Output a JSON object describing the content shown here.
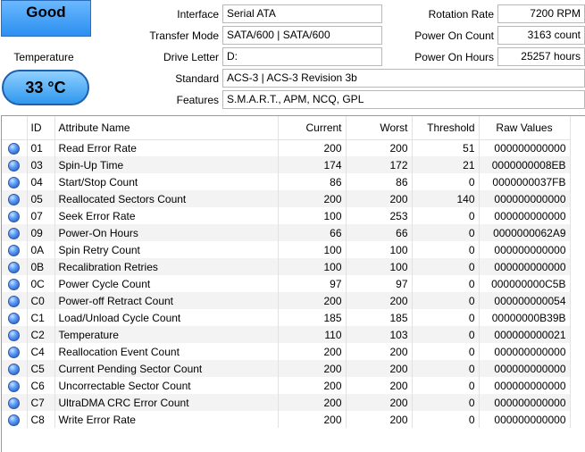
{
  "health": {
    "status": "Good"
  },
  "temperature": {
    "label": "Temperature",
    "value": "33 °C"
  },
  "info": {
    "interface": {
      "label": "Interface",
      "value": "Serial ATA"
    },
    "transfer_mode": {
      "label": "Transfer Mode",
      "value": "SATA/600 | SATA/600"
    },
    "drive_letter": {
      "label": "Drive Letter",
      "value": "D:"
    },
    "standard": {
      "label": "Standard",
      "value": "ACS-3 | ACS-3 Revision 3b"
    },
    "features": {
      "label": "Features",
      "value": "S.M.A.R.T., APM, NCQ, GPL"
    },
    "rotation_rate": {
      "label": "Rotation Rate",
      "value": "7200 RPM"
    },
    "power_on_count": {
      "label": "Power On Count",
      "value": "3163 count"
    },
    "power_on_hours": {
      "label": "Power On Hours",
      "value": "25257 hours"
    }
  },
  "colors": {
    "status_good": "#3a93ef",
    "status_dot": "#2f6fe0"
  },
  "table": {
    "headers": {
      "id": "ID",
      "name": "Attribute Name",
      "current": "Current",
      "worst": "Worst",
      "threshold": "Threshold",
      "raw": "Raw Values"
    },
    "status_icon": "status-dot-icon",
    "rows": [
      {
        "id": "01",
        "name": "Read Error Rate",
        "current": "200",
        "worst": "200",
        "threshold": "51",
        "raw": "000000000000"
      },
      {
        "id": "03",
        "name": "Spin-Up Time",
        "current": "174",
        "worst": "172",
        "threshold": "21",
        "raw": "0000000008EB"
      },
      {
        "id": "04",
        "name": "Start/Stop Count",
        "current": "86",
        "worst": "86",
        "threshold": "0",
        "raw": "0000000037FB"
      },
      {
        "id": "05",
        "name": "Reallocated Sectors Count",
        "current": "200",
        "worst": "200",
        "threshold": "140",
        "raw": "000000000000"
      },
      {
        "id": "07",
        "name": "Seek Error Rate",
        "current": "100",
        "worst": "253",
        "threshold": "0",
        "raw": "000000000000"
      },
      {
        "id": "09",
        "name": "Power-On Hours",
        "current": "66",
        "worst": "66",
        "threshold": "0",
        "raw": "0000000062A9"
      },
      {
        "id": "0A",
        "name": "Spin Retry Count",
        "current": "100",
        "worst": "100",
        "threshold": "0",
        "raw": "000000000000"
      },
      {
        "id": "0B",
        "name": "Recalibration Retries",
        "current": "100",
        "worst": "100",
        "threshold": "0",
        "raw": "000000000000"
      },
      {
        "id": "0C",
        "name": "Power Cycle Count",
        "current": "97",
        "worst": "97",
        "threshold": "0",
        "raw": "000000000C5B"
      },
      {
        "id": "C0",
        "name": "Power-off Retract Count",
        "current": "200",
        "worst": "200",
        "threshold": "0",
        "raw": "000000000054"
      },
      {
        "id": "C1",
        "name": "Load/Unload Cycle Count",
        "current": "185",
        "worst": "185",
        "threshold": "0",
        "raw": "00000000B39B"
      },
      {
        "id": "C2",
        "name": "Temperature",
        "current": "110",
        "worst": "103",
        "threshold": "0",
        "raw": "000000000021"
      },
      {
        "id": "C4",
        "name": "Reallocation Event Count",
        "current": "200",
        "worst": "200",
        "threshold": "0",
        "raw": "000000000000"
      },
      {
        "id": "C5",
        "name": "Current Pending Sector Count",
        "current": "200",
        "worst": "200",
        "threshold": "0",
        "raw": "000000000000"
      },
      {
        "id": "C6",
        "name": "Uncorrectable Sector Count",
        "current": "200",
        "worst": "200",
        "threshold": "0",
        "raw": "000000000000"
      },
      {
        "id": "C7",
        "name": "UltraDMA CRC Error Count",
        "current": "200",
        "worst": "200",
        "threshold": "0",
        "raw": "000000000000"
      },
      {
        "id": "C8",
        "name": "Write Error Rate",
        "current": "200",
        "worst": "200",
        "threshold": "0",
        "raw": "000000000000"
      }
    ]
  }
}
